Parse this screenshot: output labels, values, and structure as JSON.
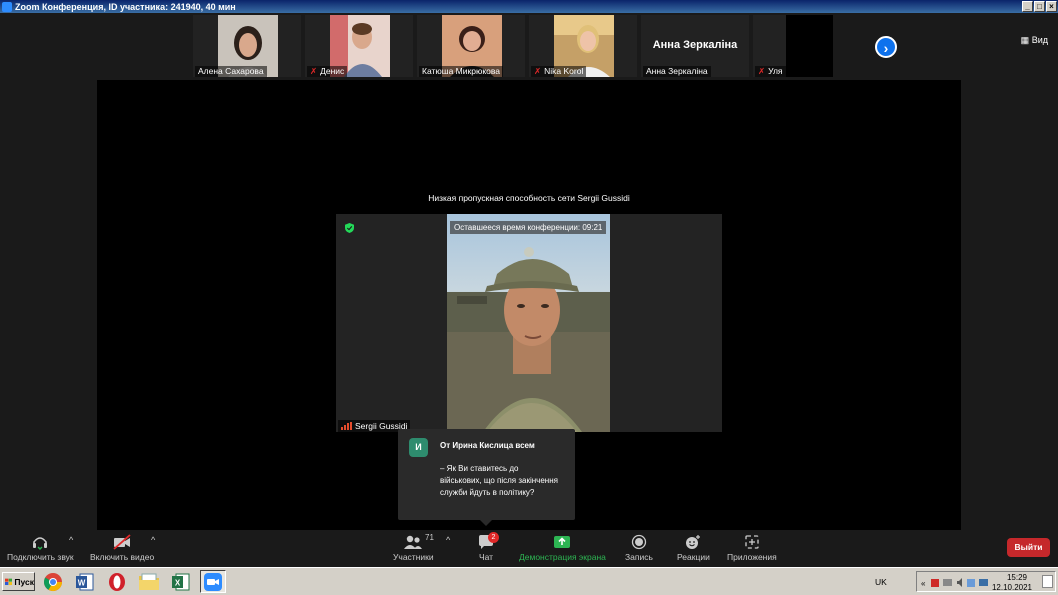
{
  "window": {
    "title": "Zoom Конференция, ID участника: 241940, 40 мин",
    "minimize_label": "_",
    "maximize_label": "□",
    "close_label": "×"
  },
  "top_strip": {
    "thumbnails": [
      {
        "name": "Алена Сахарова",
        "muted": false
      },
      {
        "name": "Денис",
        "muted": true
      },
      {
        "name": "Катюша Микрюкова",
        "muted": false
      },
      {
        "name": "Nika Korol",
        "muted": true
      },
      {
        "name": "Анна Зеркаліна",
        "muted": false,
        "display_name": "Анна Зеркаліна"
      },
      {
        "name": "Уля",
        "muted": true
      }
    ],
    "next_label": "›",
    "view_label": "Вид"
  },
  "stage": {
    "bandwidth_message": "Низкая пропускная способность сети Sergii Gussidi",
    "remaining_time": "Оставшееся время конференции: 09:21",
    "speaker_name": "Sergii Gussidi"
  },
  "chat_popup": {
    "avatar_letter": "И",
    "from": "От Ирина Кислица всем",
    "message": "– Як Ви ставитесь до військових, що після закінчення служби йдуть в політику?"
  },
  "toolbar": {
    "audio_label": "Подключить звук",
    "video_label": "Включить видео",
    "participants_label": "Участники",
    "participants_count": "71",
    "chat_label": "Чат",
    "chat_badge": "2",
    "share_label": "Демонстрация экрана",
    "record_label": "Запись",
    "reactions_label": "Реакции",
    "apps_label": "Приложения",
    "leave_label": "Выйти",
    "caret": "^"
  },
  "taskbar": {
    "start_label": "Пуск",
    "language": "UK",
    "time": "15:29",
    "date": "12.10.2021"
  },
  "colors": {
    "zoom_blue": "#0e72ed",
    "share_green": "#2db553",
    "leave_red": "#c5282b",
    "avatar_green": "#2e8c6e"
  }
}
